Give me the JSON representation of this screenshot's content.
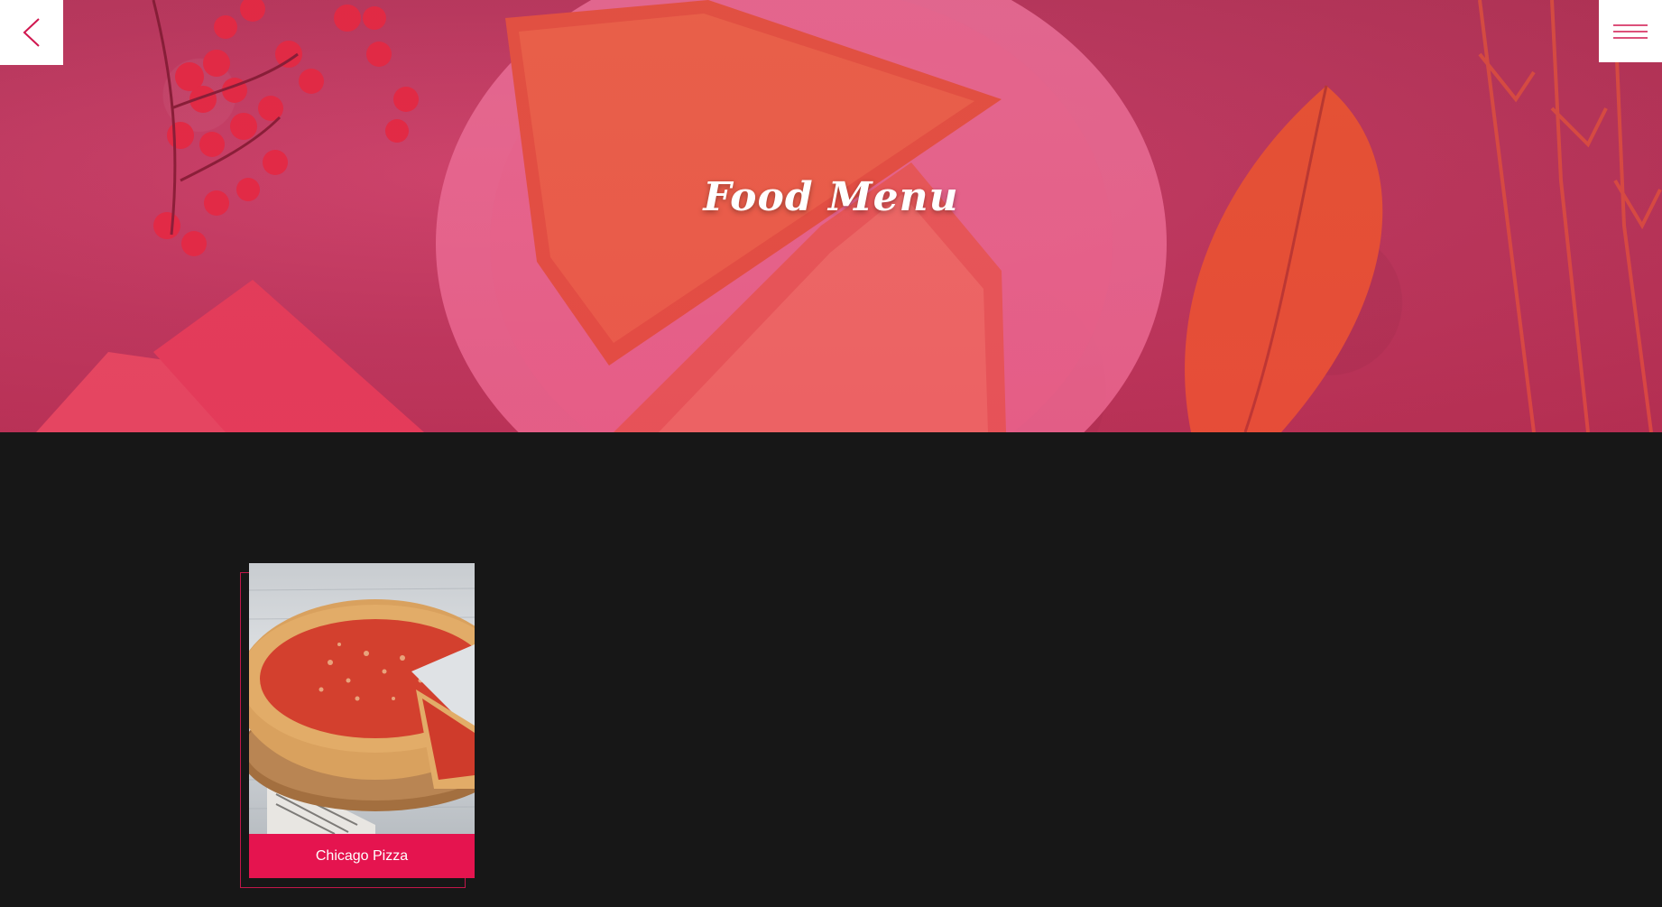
{
  "hero": {
    "title": "Food Menu"
  },
  "nav": {
    "back_icon": "chevron-left-icon",
    "menu_icon": "hamburger-menu-icon"
  },
  "menu_items": [
    {
      "name": "Chicago Pizza",
      "image": "pizza-photo"
    }
  ],
  "colors": {
    "accent": "#e5144f",
    "background": "#171717",
    "hero_tint": "#c8486e",
    "icon": "#d0164e"
  }
}
